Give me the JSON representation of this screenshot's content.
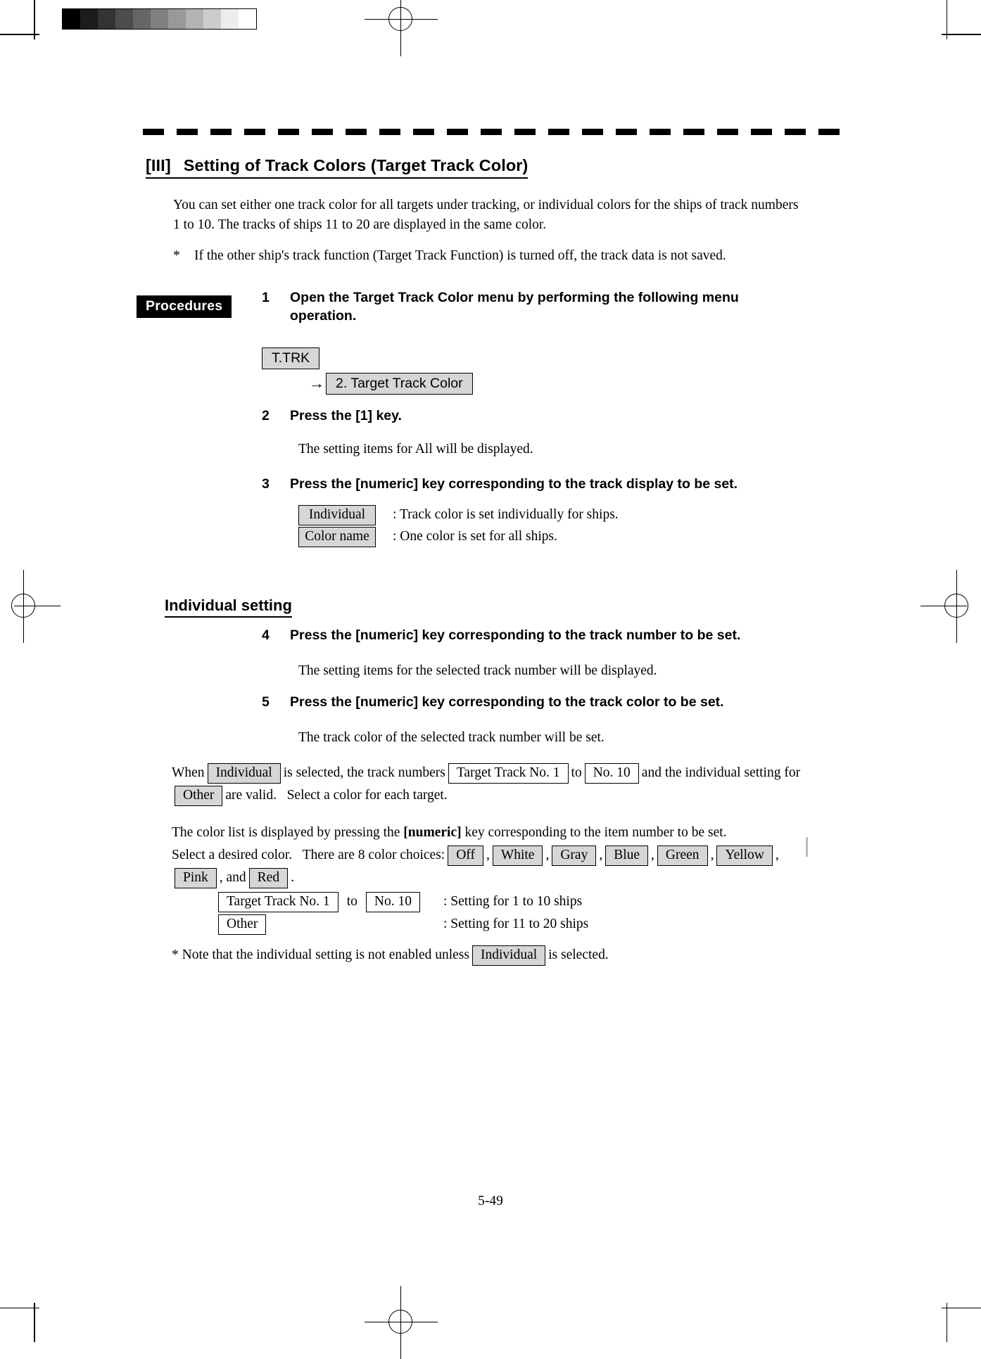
{
  "document": {
    "page_number": "5-49",
    "grayscale_strip": [
      "#000000",
      "#1c1c1c",
      "#333333",
      "#4d4d4d",
      "#666666",
      "#808080",
      "#999999",
      "#b3b3b3",
      "#cccccc",
      "#ededed",
      "#ffffff"
    ]
  },
  "chapter": {
    "number": "[III]",
    "title": "Setting of Track Colors (Target Track Color)"
  },
  "intro": {
    "paragraph": "You can set either one track color for all targets under tracking, or individual colors for the ships of track numbers 1 to 10. The tracks of ships 11 to 20 are displayed in the same color.",
    "note_marker": "*",
    "note_text": "If the other ship's track function (Target Track Function) is turned off, the track data is not saved."
  },
  "procedures": {
    "badge_label": "Procedures",
    "steps": [
      {
        "number": "1",
        "text": "Open the Target Track Color menu by performing the following menu operation."
      },
      {
        "number": "2",
        "text": "Press the [1] key."
      },
      {
        "number": "3",
        "text": "Press the [numeric] key corresponding to the track display to be set."
      },
      {
        "number": "4",
        "text": "Press the [numeric] key corresponding to the track number to be set."
      },
      {
        "number": "5",
        "text": "Press the [numeric] key corresponding to the track color to be set."
      }
    ],
    "step2_result": "The setting items for All will be displayed.",
    "step4_result": "The setting items for the selected track number will be displayed.",
    "step5_result": "The track color of the selected track number will be set."
  },
  "menu_path": {
    "first_key": "T.TRK",
    "arrow": "→",
    "second_key": "2. Target Track Color"
  },
  "track_display_choices": [
    {
      "key": "Individual",
      "description": ": Track color is set individually for ships."
    },
    {
      "key": "Color name",
      "description": ": One color is set for all ships."
    }
  ],
  "individual_setting": {
    "heading": "Individual setting",
    "when_paragraph": {
      "part1": "When",
      "key_individual": "Individual",
      "part2": "is selected, the track numbers",
      "key_range_start": "Target Track No. 1",
      "part3": "to",
      "key_range_end": "No. 10",
      "part4": "and the individual setting for",
      "key_other": "Other",
      "part5": "are valid.",
      "part6": "Select a color for each target."
    },
    "color_list_paragraph": {
      "part1": "The color list is displayed by pressing the",
      "bold_numeric": "[numeric]",
      "part2": "key corresponding to the item number to be set.",
      "part3": "Select a desired color.",
      "part4": "There are 8 color choices:",
      "colors": [
        "Off",
        "White",
        "Gray",
        "Blue",
        "Green",
        "Yellow",
        "Pink",
        "Red"
      ],
      "connector_and": ", and",
      "terminator": "."
    },
    "range_table": [
      {
        "key_start": "Target Track No. 1",
        "separator": "to",
        "key_end": "No. 10",
        "description": ": Setting for 1 to 10 ships"
      },
      {
        "key_start": "Other",
        "separator": "",
        "key_end": "",
        "description": ": Setting for 11 to 20 ships"
      }
    ],
    "bottom_note": {
      "part1": "* Note that the individual setting is not enabled unless",
      "key": "Individual",
      "part2": "is selected."
    }
  }
}
